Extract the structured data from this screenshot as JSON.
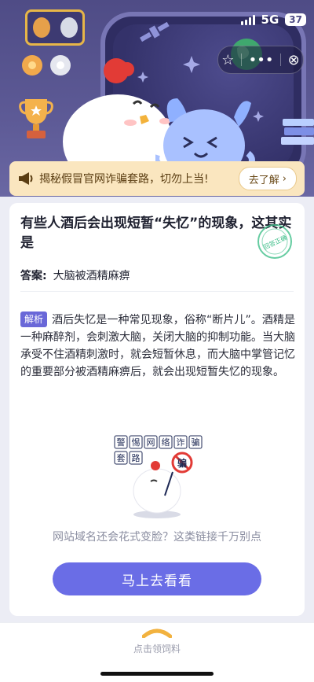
{
  "status_bar": {
    "network": "5G",
    "battery": "37"
  },
  "notice": {
    "text": "揭秘假冒官网诈骗套路，切勿上当!",
    "button_label": "去了解",
    "button_arrow": "›"
  },
  "question": {
    "title": "有些人酒后会出现短暂“失忆”的现象，这其实是",
    "answer_label": "答案:",
    "answer_value": "大脑被酒精麻痹",
    "analysis_tag": "解析",
    "analysis_text": "酒后失忆是一种常见现象，俗称“断片儿”。酒精是一种麻醉剂，会刺激大脑，关闭大脑的抑制功能。当大脑承受不住酒精刺激时，就会短暂休息，而大脑中掌管记忆的重要部分被酒精麻痹后，就会出现短暂失忆的现象。",
    "stamp_text": "回答正确"
  },
  "fraud_banner": {
    "sign_row1": [
      "警",
      "惕",
      "网",
      "络",
      "诈",
      "骗"
    ],
    "sign_row2": [
      "套",
      "路"
    ],
    "warning_char": "骗",
    "hint": "网站域名还会花式变脸？这类链接千万别点",
    "cta_label": "马上去看看"
  },
  "bottom_bar": {
    "label": "点击领饲料"
  },
  "colors": {
    "accent": "#6a6de6",
    "hero_bg": "#4f4c86",
    "notice_bg": "#fae6bf"
  },
  "icons": [
    "star-icon",
    "more-icon",
    "close-icon",
    "megaphone-icon",
    "chevron-right-icon",
    "feed-icon"
  ]
}
